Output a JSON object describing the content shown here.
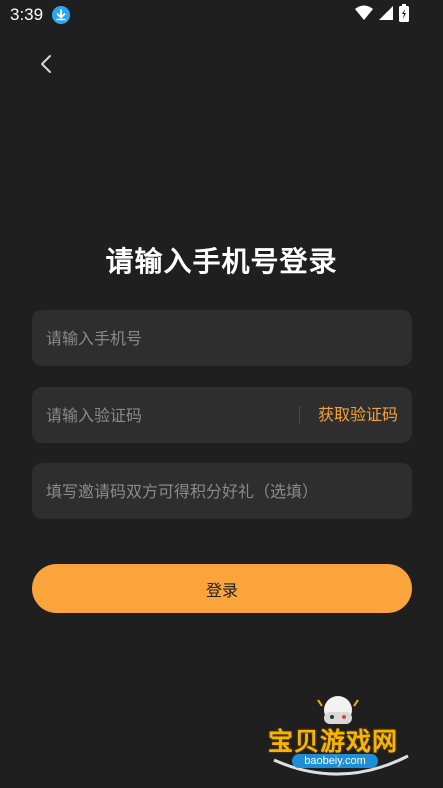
{
  "status_bar": {
    "time": "3:39",
    "icons": [
      "download-icon",
      "wifi-icon",
      "signal-icon",
      "battery-icon"
    ]
  },
  "header": {
    "back_icon": "chevron-left-icon"
  },
  "title": "请输入手机号登录",
  "form": {
    "phone_placeholder": "请输入手机号",
    "code_placeholder": "请输入验证码",
    "get_code_label": "获取验证码",
    "invite_placeholder": "填写邀请码双方可得积分好礼（选填）",
    "login_label": "登录"
  },
  "watermark": {
    "title": "宝贝游戏网",
    "url": "baobeiy.com"
  },
  "colors": {
    "background": "#1f1f1f",
    "field_bg": "#2e2e2e",
    "accent": "#fba43b",
    "link": "#f5a23a",
    "placeholder": "#8a8a8a"
  }
}
